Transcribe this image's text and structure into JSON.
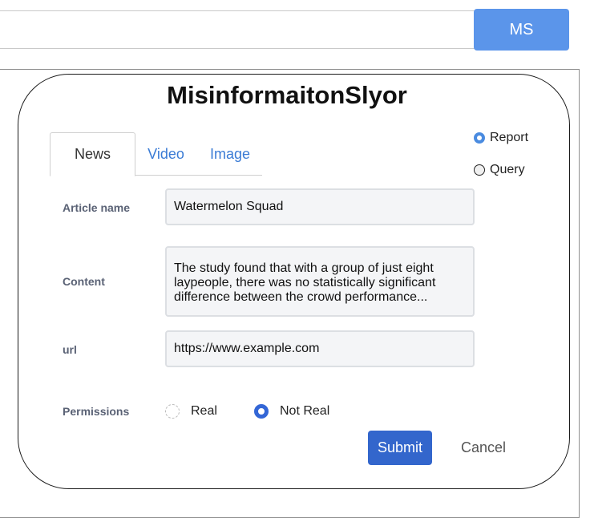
{
  "header": {
    "ms_label": "MS"
  },
  "app": {
    "title": "MisinformaitonSlyor"
  },
  "tabs": [
    {
      "label": "News",
      "active": true
    },
    {
      "label": "Video",
      "active": false
    },
    {
      "label": "Image",
      "active": false
    }
  ],
  "mode": {
    "options": [
      {
        "label": "Report",
        "selected": true
      },
      {
        "label": "Query",
        "selected": false
      }
    ]
  },
  "form": {
    "article_label": "Article name",
    "article_value": "Watermelon Squad",
    "content_label": "Content",
    "content_value": "The study found that with a group of just eight laypeople, there was no statistically significant difference between the crowd performance...",
    "url_label": "url",
    "url_value": "https://www.example.com",
    "permissions_label": "Permissions",
    "permissions": [
      {
        "label": "Real",
        "selected": false
      },
      {
        "label": "Not Real",
        "selected": true
      }
    ]
  },
  "actions": {
    "submit_label": "Submit",
    "cancel_label": "Cancel"
  },
  "colors": {
    "accent": "#5b95ea",
    "primary_button": "#3366cc",
    "tab_link": "#3a7bd5"
  }
}
